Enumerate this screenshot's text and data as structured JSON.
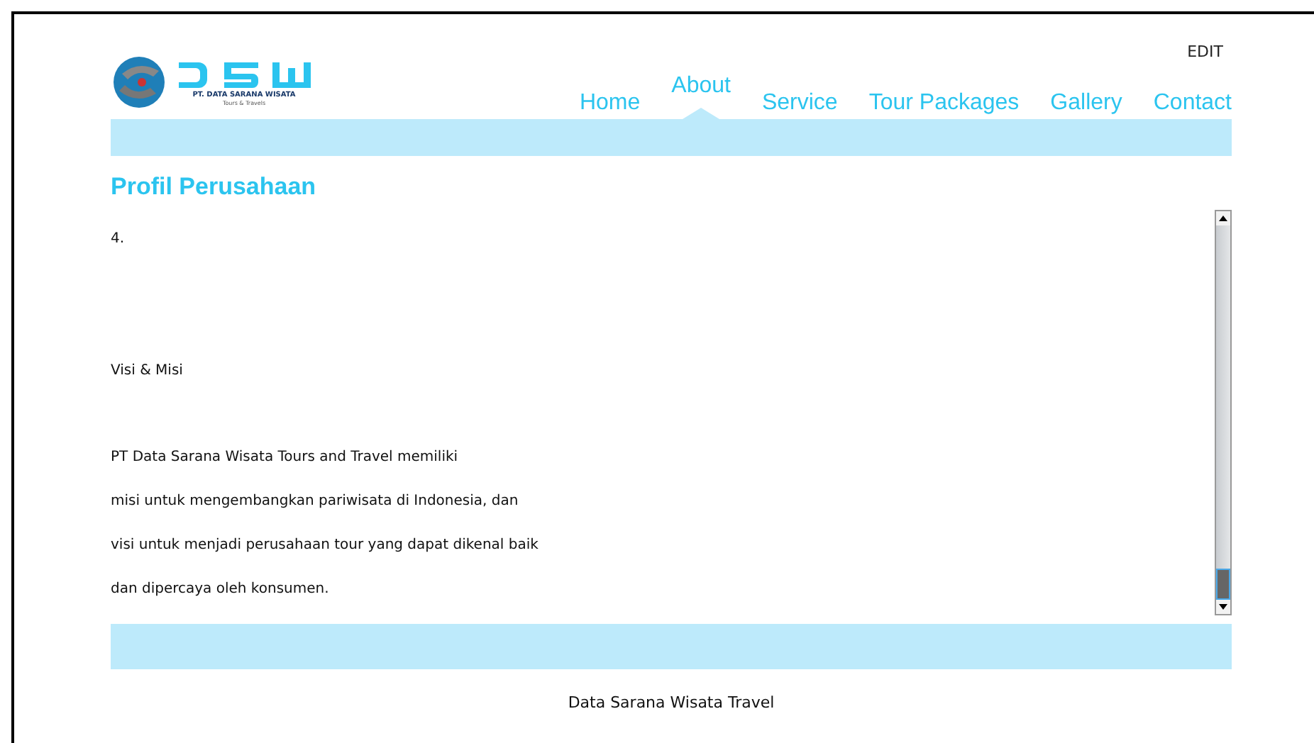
{
  "header": {
    "company": "PT. DATA SARANA WISATA",
    "tagline": "Tours & Travels",
    "edit": "EDIT"
  },
  "nav": [
    {
      "label": "Home",
      "selected": false
    },
    {
      "label": "About",
      "selected": true
    },
    {
      "label": "Service",
      "selected": false
    },
    {
      "label": "Tour Packages",
      "selected": false
    },
    {
      "label": "Gallery",
      "selected": false
    },
    {
      "label": "Contact",
      "selected": false
    }
  ],
  "section_title": "Profil Perusahaan",
  "content": [
    {
      "kind": "line",
      "text": "4."
    },
    {
      "kind": "gap"
    },
    {
      "kind": "line",
      "text": "Visi & Misi"
    },
    {
      "kind": "gap-small"
    },
    {
      "kind": "line",
      "text": "PT Data Sarana Wisata Tours and Travel memiliki"
    },
    {
      "kind": "line",
      "text": "misi untuk mengembangkan pariwisata di Indonesia, dan"
    },
    {
      "kind": "line",
      "text": "visi untuk menjadi perusahaan tour yang dapat dikenal baik"
    },
    {
      "kind": "line",
      "text": "dan dipercaya oleh konsumen."
    }
  ],
  "footer": "Data Sarana Wisata Travel"
}
